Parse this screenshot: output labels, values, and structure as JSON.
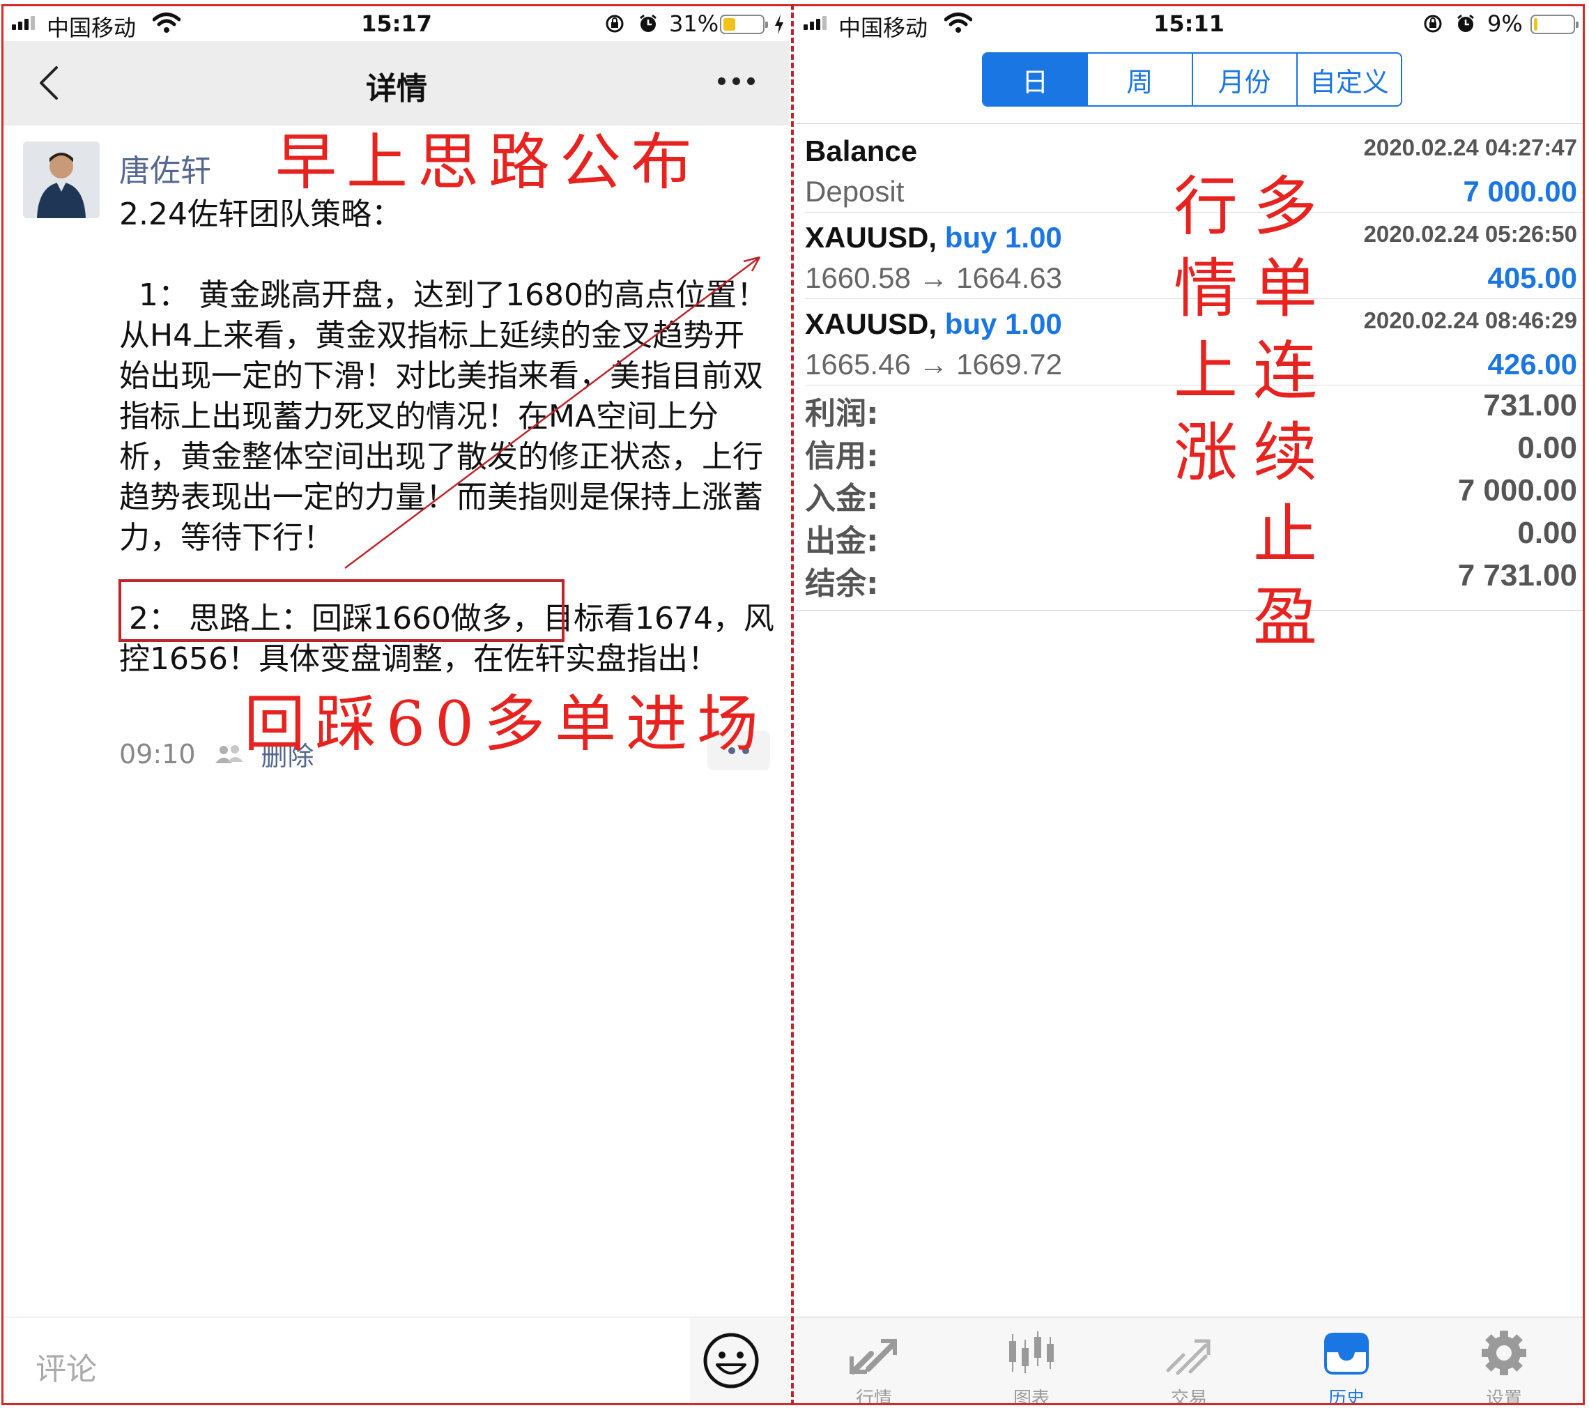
{
  "left_phone": {
    "status": {
      "carrier": "中国移动",
      "time": "15:17",
      "battery": "31%",
      "battery_level": 0.31
    },
    "nav": {
      "title": "详情"
    },
    "post": {
      "author": "唐佐轩",
      "headline": "2.24佐轩团队策略：",
      "paragraph1": "  1： 黄金跳高开盘，达到了1680的高点位置！从H4上来看，黄金双指标上延续的金叉趋势开始出现一定的下滑！对比美指来看，美指目前双指标上出现蓄力死叉的情况！在MA空间上分析，黄金整体空间出现了散发的修正状态，上行趋势表现出一定的力量！而美指则是保持上涨蓄力，等待下行！",
      "paragraph2": " 2： 思路上：回踩1660做多，目标看1674，风控1656！具体变盘调整，在佐轩实盘指出！",
      "time": "09:10",
      "delete_label": "删除"
    },
    "comment": {
      "placeholder": "评论"
    }
  },
  "annotations": {
    "morning": "早上思路公布",
    "entry": "回踩60多单进场",
    "col1": "行情上涨",
    "col2": "多单连续止盈"
  },
  "right_phone": {
    "status": {
      "carrier": "中国移动",
      "time": "15:11",
      "battery": "9%",
      "battery_level": 0.09
    },
    "segments": [
      "日",
      "周",
      "月份",
      "自定义"
    ],
    "active_segment": "日",
    "deals": [
      {
        "title": "Balance",
        "type": "",
        "time": "2020.02.24 04:27:47",
        "detail": "Deposit",
        "amount": "7 000.00"
      },
      {
        "title": "XAUUSD,",
        "type": "buy 1.00",
        "time": "2020.02.24 05:26:50",
        "detail": "1660.58 → 1664.63",
        "amount": "405.00"
      },
      {
        "title": "XAUUSD,",
        "type": "buy 1.00",
        "time": "2020.02.24 08:46:29",
        "detail": "1665.46 → 1669.72",
        "amount": "426.00"
      }
    ],
    "summary": [
      {
        "label": "利润:",
        "value": "731.00"
      },
      {
        "label": "信用:",
        "value": "0.00"
      },
      {
        "label": "入金:",
        "value": "7 000.00"
      },
      {
        "label": "出金:",
        "value": "0.00"
      },
      {
        "label": "结余:",
        "value": "7 731.00"
      }
    ],
    "tabs": [
      {
        "label": "行情",
        "icon": "quotes-icon"
      },
      {
        "label": "图表",
        "icon": "chart-icon"
      },
      {
        "label": "交易",
        "icon": "trade-icon"
      },
      {
        "label": "历史",
        "icon": "history-icon"
      },
      {
        "label": "设置",
        "icon": "settings-icon"
      }
    ],
    "active_tab": "历史"
  },
  "colors": {
    "accent_blue": "#1a76e2",
    "annotation_red": "#e8231f",
    "link_blue": "#54678f",
    "battery_yellow": "#f2c419"
  }
}
